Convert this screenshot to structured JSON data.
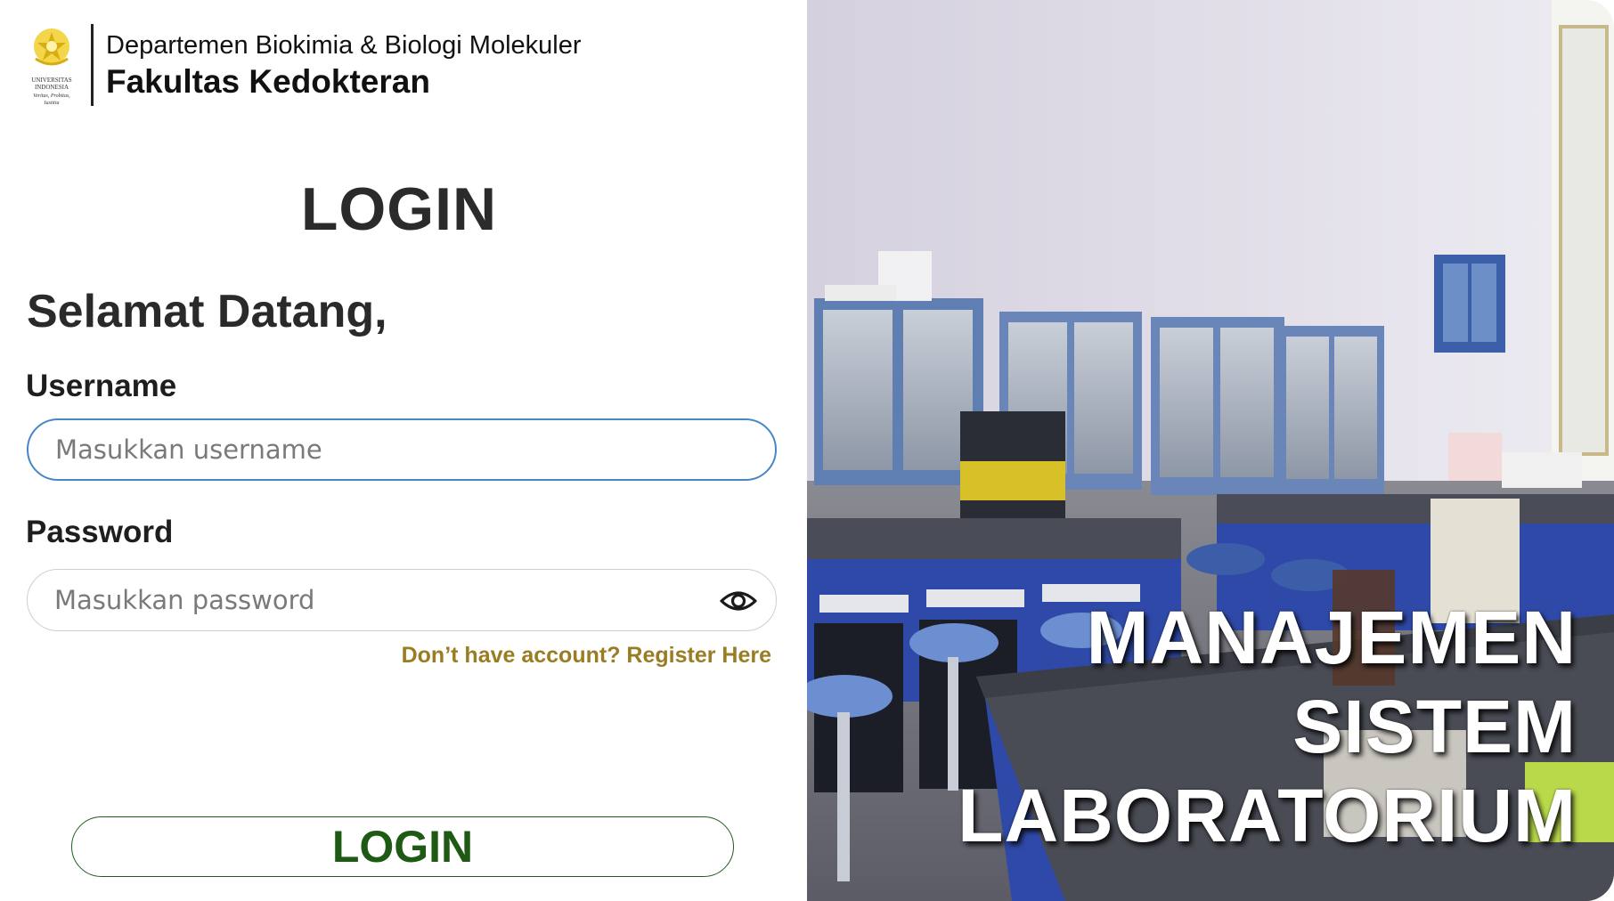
{
  "header": {
    "logo_line1": "UNIVERSITAS",
    "logo_line2": "INDONESIA",
    "logo_motto": "Veritas, Probitas, Iustitia",
    "department": "Departemen Biokimia & Biologi Molekuler",
    "faculty": "Fakultas Kedokteran"
  },
  "form": {
    "title": "LOGIN",
    "welcome": "Selamat Datang,",
    "username_label": "Username",
    "username_placeholder": "Masukkan username",
    "password_label": "Password",
    "password_placeholder": "Masukkan password",
    "register_link": "Don’t have account? Register Here",
    "submit_label": "LOGIN"
  },
  "hero": {
    "line1": "MANAJEMEN",
    "line2": "SISTEM",
    "line3": "LABORATORIUM"
  },
  "colors": {
    "username_border": "#4a86c7",
    "register_link": "#9a7d22",
    "login_button_text": "#1f5a14",
    "logo_gold": "#e6c229"
  },
  "icons": {
    "logo": "university-logo-icon",
    "password_toggle": "eye-icon"
  }
}
